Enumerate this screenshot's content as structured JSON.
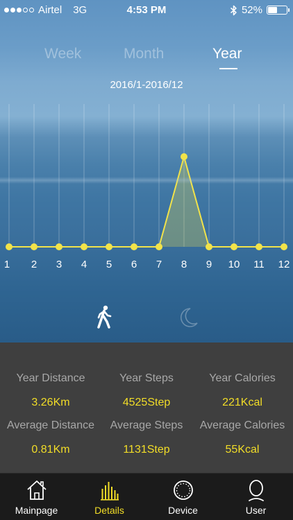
{
  "status_bar": {
    "carrier": "Airtel",
    "network": "3G",
    "time": "4:53 PM",
    "battery_percent": "52%",
    "battery_level": 0.52,
    "signal_bars_filled": 3,
    "signal_bars_total": 5
  },
  "tabs": [
    {
      "label": "Week",
      "active": false
    },
    {
      "label": "Month",
      "active": false
    },
    {
      "label": "Year",
      "active": true
    }
  ],
  "date_range": "2016/1-2016/12",
  "chart_data": {
    "type": "area",
    "categories": [
      "1",
      "2",
      "3",
      "4",
      "5",
      "6",
      "7",
      "8",
      "9",
      "10",
      "11",
      "12"
    ],
    "series": [
      {
        "values": [
          0,
          0,
          0,
          0,
          0,
          0,
          0,
          4525,
          0,
          0,
          0,
          0
        ]
      }
    ],
    "title": "",
    "xlabel": "",
    "ylabel": "",
    "grid": "vertical",
    "line_color": "#f2e34a"
  },
  "modes": [
    {
      "icon": "walking-icon",
      "active": true
    },
    {
      "icon": "moon-icon",
      "active": false
    }
  ],
  "stats": {
    "year_distance_label": "Year Distance",
    "year_distance_value": "3.26Km",
    "year_steps_label": "Year Steps",
    "year_steps_value": "4525Step",
    "year_calories_label": "Year Calories",
    "year_calories_value": "221Kcal",
    "avg_distance_label": "Average Distance",
    "avg_distance_value": "0.81Km",
    "avg_steps_label": "Average Steps",
    "avg_steps_value": "1131Step",
    "avg_calories_label": "Average Calories",
    "avg_calories_value": "55Kcal"
  },
  "nav": [
    {
      "label": "Mainpage",
      "icon": "home-icon",
      "active": false
    },
    {
      "label": "Details",
      "icon": "bar-chart-icon",
      "active": true
    },
    {
      "label": "Device",
      "icon": "watch-icon",
      "active": false
    },
    {
      "label": "User",
      "icon": "user-icon",
      "active": false
    }
  ],
  "colors": {
    "accent": "#f2dd27",
    "stats_background": "#3f3f3f",
    "nav_background": "#1b1b1b"
  }
}
